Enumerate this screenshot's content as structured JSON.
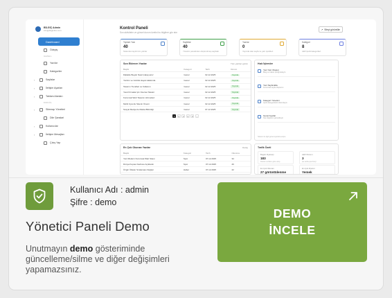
{
  "preview": {
    "profile": {
      "name": "BİLGİÇ Admin",
      "email": "info@bilgicilim.com"
    },
    "sidebar": {
      "active": "Dashboard",
      "items": [
        {
          "section": "",
          "label": "Ödeyiş"
        },
        {
          "section": "GENEL",
          "label": "Yazılar"
        },
        {
          "section": "",
          "label": "Kategoriler"
        },
        {
          "section": "",
          "label": "Sayfalar",
          "sub": true
        },
        {
          "section": "",
          "label": "İletişim Ayarları",
          "sub": true
        },
        {
          "section": "",
          "label": "Tablam Alanları",
          "sub": true
        },
        {
          "section": "MODÜL",
          "label": "Sitemap Yönetimi",
          "sub": true
        },
        {
          "section": "",
          "label": "Dile Şanslari"
        },
        {
          "section": "",
          "label": "Kullanıcılar",
          "sub": true
        },
        {
          "section": "",
          "label": "İletişim Mesajları",
          "sub": true
        },
        {
          "section": "",
          "label": "Çıkış Yap"
        }
      ]
    },
    "header": {
      "title": "Kontrol Paneli",
      "subtitle": "Son aktiviteler ve güncel durum özetini bu bilgilere göz atın",
      "button": "Siteyi görüntüle"
    },
    "stats": [
      {
        "label": "Toplam Yazı",
        "value": "40",
        "desc": "Sistemde kayıtlı tüm yazılar",
        "color": "#4a80c9"
      },
      {
        "label": "Sayfalar",
        "value": "40",
        "desc": "Yönetim panelinden oluşturulmuş sayfalar",
        "color": "#3c9d46"
      },
      {
        "label": "Yazılar",
        "value": "0",
        "desc": "Yayında olan sayfa ve yazı içerikleri",
        "color": "#e0a830"
      },
      {
        "label": "Kategori",
        "value": "8",
        "desc": "Aktif içerik kategorileri",
        "color": "#6b7de0"
      }
    ],
    "recent": {
      "title": "Son Eklenen Yazılar",
      "link": "Tüm yazıları görün",
      "columns": [
        "Başlık",
        "Kategori",
        "Tarih",
        "Durum"
      ],
      "rows": [
        [
          "Dijitalde Bugün Nasıl Çalışıyoruz",
          "Genel",
          "02.12.2025",
          "Yayında"
        ],
        [
          "Yazılım ve Günlük Hayat Hakkında",
          "Genel",
          "02.12.2025",
          "Yayında"
        ],
        [
          "Tasarım Trendleri ve Kullanım",
          "Genel",
          "02.12.2025",
          "Yayında"
        ],
        [
          "Yerel Firmalar için İnternet Siteleri",
          "Genel",
          "02.12.2025",
          "Yayında"
        ],
        [
          "Kurumsal Web Tasarım Hizmetleri",
          "Genel",
          "02.12.2025",
          "Yayında"
        ],
        [
          "Mobil Uyumlu Sitenin Önemi",
          "Genel",
          "02.12.2025",
          "Yayında"
        ],
        [
          "Sosyal Medya ile Marka Bilinirliği",
          "Genel",
          "07.12.2025",
          "Yayında"
        ]
      ],
      "pages": [
        "1",
        "2",
        "3",
        "4",
        "5",
        "›"
      ]
    },
    "activity": {
      "title": "Hızlı İşlemler",
      "items": [
        {
          "title": "Yeni Yazı Oluştur",
          "desc": "Blog ve haber içeriği ekleyin"
        },
        {
          "title": "Yeni Sayfa Ekle",
          "desc": "Kurumsal sayfa oluşturun"
        },
        {
          "title": "Kategori Yönetimi",
          "desc": "İçerik kategorilerini düzenleyin"
        },
        {
          "title": "Genel Ayarlar",
          "desc": "Site bilgilerini güncelleyin"
        }
      ],
      "footer": "Sistem ile ilgili genel ayarlara erişin"
    },
    "popular": {
      "title": "En Çok Okunan Yazılar",
      "link": "Detay",
      "columns": [
        "Başlık",
        "Kategori",
        "Tarih",
        "Okunma"
      ],
      "rows": [
        [
          "Yeni Modern Kurumsal Web Sitesi",
          "Spor",
          "07.12.2025",
          "34"
        ],
        [
          "Dünya Kupası Kadrosu Açıklandı",
          "Spor",
          "07.12.2025",
          "26"
        ],
        [
          "Özgür Ülkeler Sıralaması Değişti",
          "Haber",
          "07.12.2025",
          "22"
        ],
        [
          "Yapay Zeka Yeni Dönemi Başlattı",
          "Teknoloji",
          "07.12.2025",
          "18"
        ],
        [
          "Beşiktaş Derbiye Hazır",
          "Spor",
          "07.12.2025",
          "15"
        ],
        [
          "Müzik Festivali Tarihleri Belli Oldu",
          "Kültür",
          "07.12.2025",
          "11"
        ]
      ],
      "footer": "Bu tablo son 30 günlük okunma verilerine göre hazırlanmıştır"
    },
    "traffic": {
      "title": "Trafik Özeti",
      "tiles": [
        {
          "label": "Bugün Ziyaretçi",
          "value": "183",
          "desc": "Dünkü verilere göre artış"
        },
        {
          "label": "Aktif Oturum",
          "value": "3",
          "desc": "Şu anda çevrimiçi"
        },
        {
          "label": "En Çok Okunan",
          "value": "27 görüntülenme",
          "desc": "Son 24 saatlik veriler"
        },
        {
          "label": "En Çok Ziyaret",
          "value": "Yemek",
          "desc": "Kategori bazlı"
        }
      ],
      "footer": "Trafik verileri anlık olarak güncellenmektedir"
    }
  },
  "credentials": {
    "username_line": "Kullanıcı Adı : admin",
    "password_line": "Şifre : demo"
  },
  "title": "Yönetici Paneli Demo",
  "notice": {
    "before": "Unutmayın ",
    "bold": "demo",
    "after": " gösteriminde güncelleme/silme ve diğer değişimleri yapamazsınız."
  },
  "cta": {
    "line1": "DEMO",
    "line2": "İNCELE"
  },
  "colors": {
    "accent": "#7aa83f",
    "icon_box": "#6f9c3c"
  }
}
